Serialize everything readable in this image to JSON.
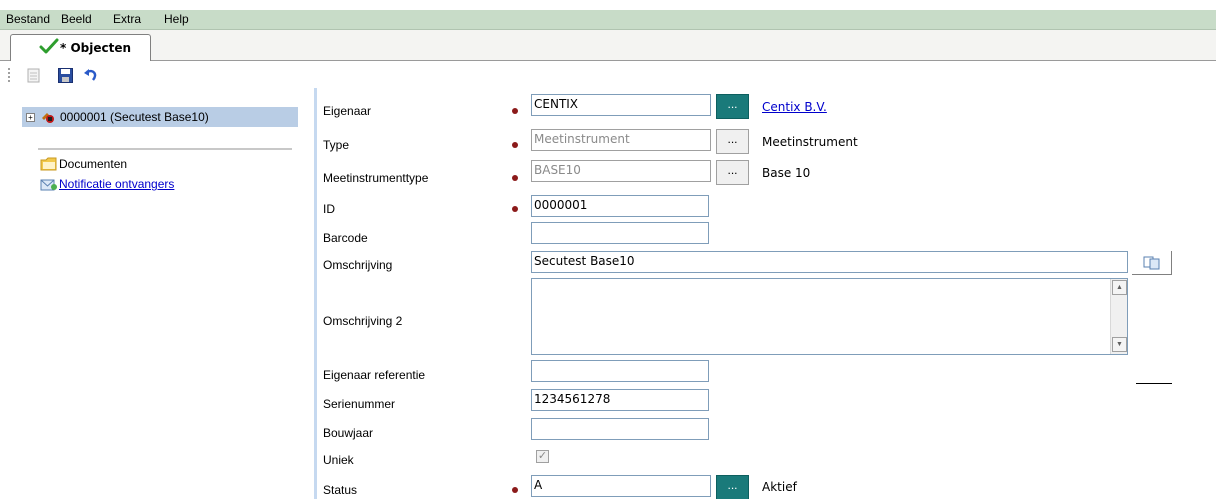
{
  "menu": {
    "items": [
      {
        "label": "Bestand"
      },
      {
        "label": "Beeld"
      },
      {
        "label": "Extra"
      },
      {
        "label": "Help"
      }
    ]
  },
  "tabs": [
    {
      "label": "* Objecten",
      "icon": "check-icon",
      "color": "#2e9e2e"
    }
  ],
  "toolbar": {
    "icons": [
      "page-icon",
      "save-icon",
      "undo-icon"
    ]
  },
  "tree": {
    "root": {
      "label": "0000001 (Secutest Base10)",
      "icon": "instrument-icon",
      "expander": "+"
    },
    "children": [
      {
        "label": "Documenten",
        "icon": "folder-icon",
        "link": false
      },
      {
        "label": "Notificatie ontvangers",
        "icon": "mail-users-icon",
        "link": true
      }
    ]
  },
  "form": {
    "eigenaar": {
      "label": "Eigenaar",
      "value": "CENTIX",
      "button": "...",
      "ref": "Centix B.V."
    },
    "type": {
      "label": "Type",
      "value": "Meetinstrument",
      "button": "...",
      "ref": "Meetinstrument"
    },
    "meetinstrumenttype": {
      "label": "Meetinstrumenttype",
      "value": "BASE10",
      "button": "...",
      "ref": "Base 10"
    },
    "id": {
      "label": "ID",
      "value": "0000001"
    },
    "barcode": {
      "label": "Barcode",
      "value": ""
    },
    "omschrijving": {
      "label": "Omschrijving",
      "value": "Secutest Base10"
    },
    "omschrijving2": {
      "label": "Omschrijving 2",
      "value": ""
    },
    "eigenaar_referentie": {
      "label": "Eigenaar referentie",
      "value": ""
    },
    "serienummer": {
      "label": "Serienummer",
      "value": "1234561278"
    },
    "bouwjaar": {
      "label": "Bouwjaar",
      "value": ""
    },
    "uniek": {
      "label": "Uniek",
      "checked": true
    },
    "status": {
      "label": "Status",
      "value": "A",
      "button": "...",
      "ref": "Aktief"
    }
  },
  "colors": {
    "menubar": "#c8dcc8",
    "required_dot": "#8b1a1a",
    "lookup_teal": "#1a7a7a",
    "selection": "#b9cde5",
    "link": "#0000cc"
  }
}
